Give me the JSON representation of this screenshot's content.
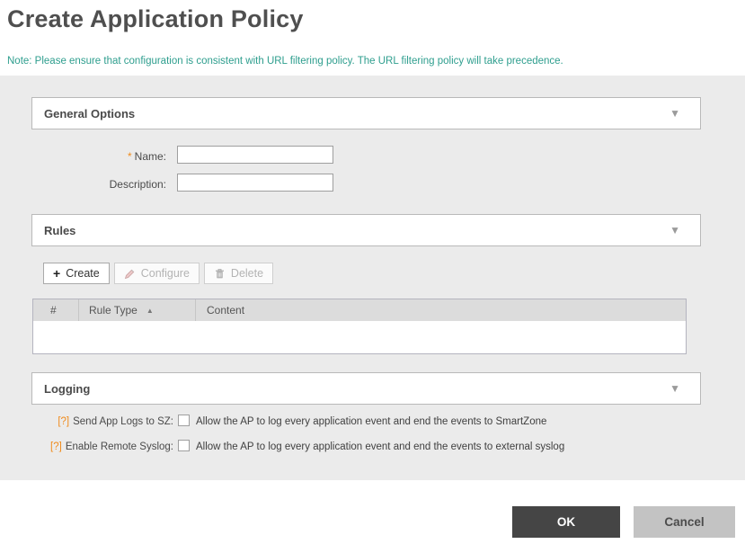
{
  "page": {
    "title": "Create Application Policy",
    "note": "Note: Please ensure that configuration is consistent with URL filtering policy. The URL filtering policy will take precedence."
  },
  "colors": {
    "note_text": "#2e9e8e",
    "required_mark": "#f08c1e",
    "help_mark": "#f08c1e",
    "panel_bg": "#ebebeb",
    "table_header_bg": "#dcdcdc",
    "ok_button_bg": "#454545",
    "cancel_button_bg": "#c3c3c3"
  },
  "icons": {
    "collapse": "▼",
    "sort_ascending": "▲",
    "plus": "+"
  },
  "sections": {
    "general": {
      "title": "General Options"
    },
    "rules": {
      "title": "Rules"
    },
    "logging": {
      "title": "Logging"
    }
  },
  "general_form": {
    "name_required_mark": "*",
    "name_label": "Name:",
    "name_value": "",
    "description_label": "Description:",
    "description_value": ""
  },
  "rules_toolbar": {
    "create_label": "Create",
    "configure_label": "Configure",
    "delete_label": "Delete",
    "configure_enabled": false,
    "delete_enabled": false
  },
  "rules_table": {
    "columns": [
      "#",
      "Rule Type",
      "Content"
    ],
    "sort_column": "Rule Type",
    "sort_direction": "ascending",
    "rows": []
  },
  "logging": {
    "send_app_logs": {
      "help_mark": "[?]",
      "label": "Send App Logs to SZ:",
      "checked": false,
      "description": "Allow the AP to log every application event and end the events to SmartZone"
    },
    "remote_syslog": {
      "help_mark": "[?]",
      "label": "Enable Remote Syslog:",
      "checked": false,
      "description": "Allow the AP to log every application event and end the events to external syslog"
    }
  },
  "footer": {
    "ok_label": "OK",
    "cancel_label": "Cancel"
  }
}
